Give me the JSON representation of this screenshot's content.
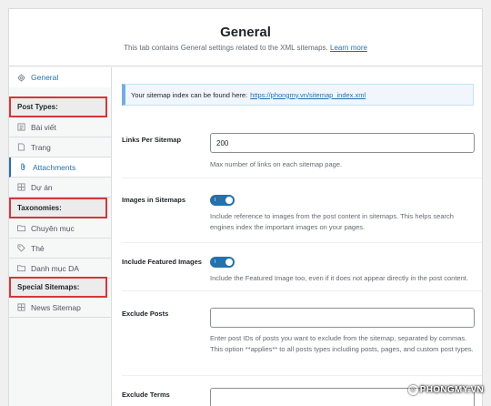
{
  "header": {
    "title": "General",
    "description": "This tab contains General settings related to the XML sitemaps.",
    "learn_more": "Learn more"
  },
  "sidebar": {
    "general": {
      "label": "General",
      "icon": "gear-icon"
    },
    "groups": [
      "Post Types:",
      "Taxonomies:",
      "Special Sitemaps:"
    ],
    "post_types": [
      {
        "label": "Bài viết",
        "icon": "posts-icon"
      },
      {
        "label": "Trang",
        "icon": "page-icon"
      },
      {
        "label": "Attachments",
        "icon": "paperclip-icon"
      },
      {
        "label": "Dự án",
        "icon": "grid-icon"
      }
    ],
    "taxonomies": [
      {
        "label": "Chuyên mục",
        "icon": "folder-icon"
      },
      {
        "label": "Thẻ",
        "icon": "tag-icon"
      },
      {
        "label": "Danh mục DA",
        "icon": "folder-icon"
      }
    ],
    "special": [
      {
        "label": "News Sitemap",
        "icon": "grid-icon"
      }
    ]
  },
  "notice": {
    "text": "Your sitemap index can be found here:",
    "link": "https://phongmy.vn/sitemap_index.xml"
  },
  "settings": {
    "links_per_sitemap": {
      "label": "Links Per Sitemap",
      "value": "200",
      "help": "Max number of links on each sitemap page."
    },
    "images_in_sitemaps": {
      "label": "Images in Sitemaps",
      "toggle": "I",
      "help": "Include reference to images from the post content in sitemaps. This helps search engines index the important images on your pages."
    },
    "include_featured_images": {
      "label": "Include Featured Images",
      "toggle": "I",
      "help": "Include the Featured Image too, even if it does not appear directly in the post content."
    },
    "exclude_posts": {
      "label": "Exclude Posts",
      "value": "",
      "help": "Enter post IDs of posts you want to exclude from the sitemap, separated by commas. This option **applies** to all posts types including posts, pages, and custom post types."
    },
    "exclude_terms": {
      "label": "Exclude Terms",
      "value": ""
    }
  },
  "watermark": "PHONGMY.VN",
  "colors": {
    "accent": "#2271b1",
    "highlight_box": "#d63638",
    "notice_bg": "#f0f6fc"
  }
}
